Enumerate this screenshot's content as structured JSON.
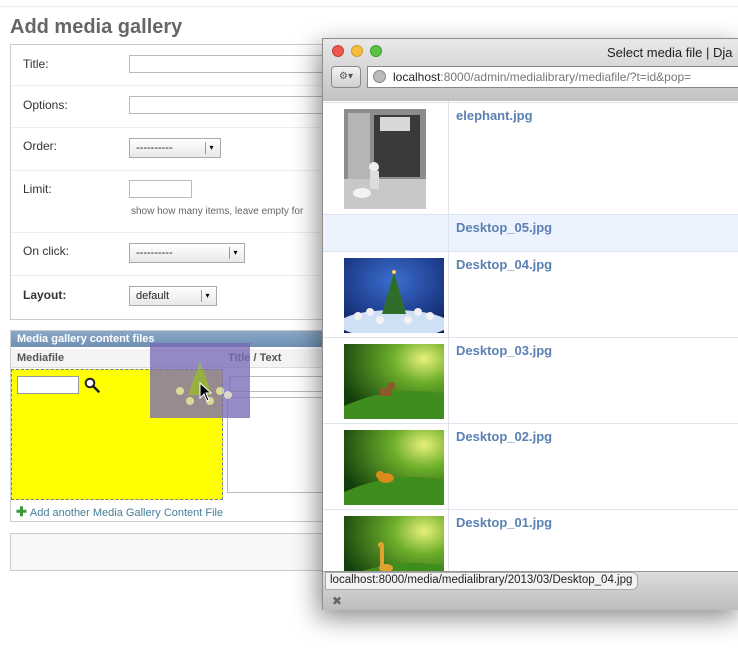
{
  "page": {
    "title": "Add media gallery",
    "fields": {
      "title_label": "Title:",
      "options_label": "Options:",
      "order_label": "Order:",
      "order_value": "----------",
      "limit_label": "Limit:",
      "limit_help": "show how many items, leave empty for",
      "onclick_label": "On click:",
      "onclick_value": "----------",
      "layout_label": "Layout:",
      "layout_value": "default"
    },
    "inline": {
      "header": "Media gallery content files",
      "col_mediafile": "Mediafile",
      "col_title": "Title / Text",
      "add_link": "Add another Media Gallery Content File"
    }
  },
  "popup": {
    "window_title": "Select media file | Dja",
    "url_host": "localhost",
    "url_rest": ":8000/admin/medialibrary/mediafile/?t=id&pop=",
    "status_url": "localhost:8000/media/medialibrary/2013/03/Desktop_04.jpg",
    "files": [
      {
        "name": "elephant.jpg",
        "thumb": "photo-bw"
      },
      {
        "name": "Desktop_05.jpg",
        "thumb": "none"
      },
      {
        "name": "Desktop_04.jpg",
        "thumb": "christmas-tree"
      },
      {
        "name": "Desktop_03.jpg",
        "thumb": "green-dog"
      },
      {
        "name": "Desktop_02.jpg",
        "thumb": "green-lion"
      },
      {
        "name": "Desktop_01.jpg",
        "thumb": "green-giraffe"
      }
    ]
  },
  "colors": {
    "accent": "#5b80b2",
    "drop_highlight": "#ffff00",
    "drag_ghost": "#7a6bb8"
  }
}
